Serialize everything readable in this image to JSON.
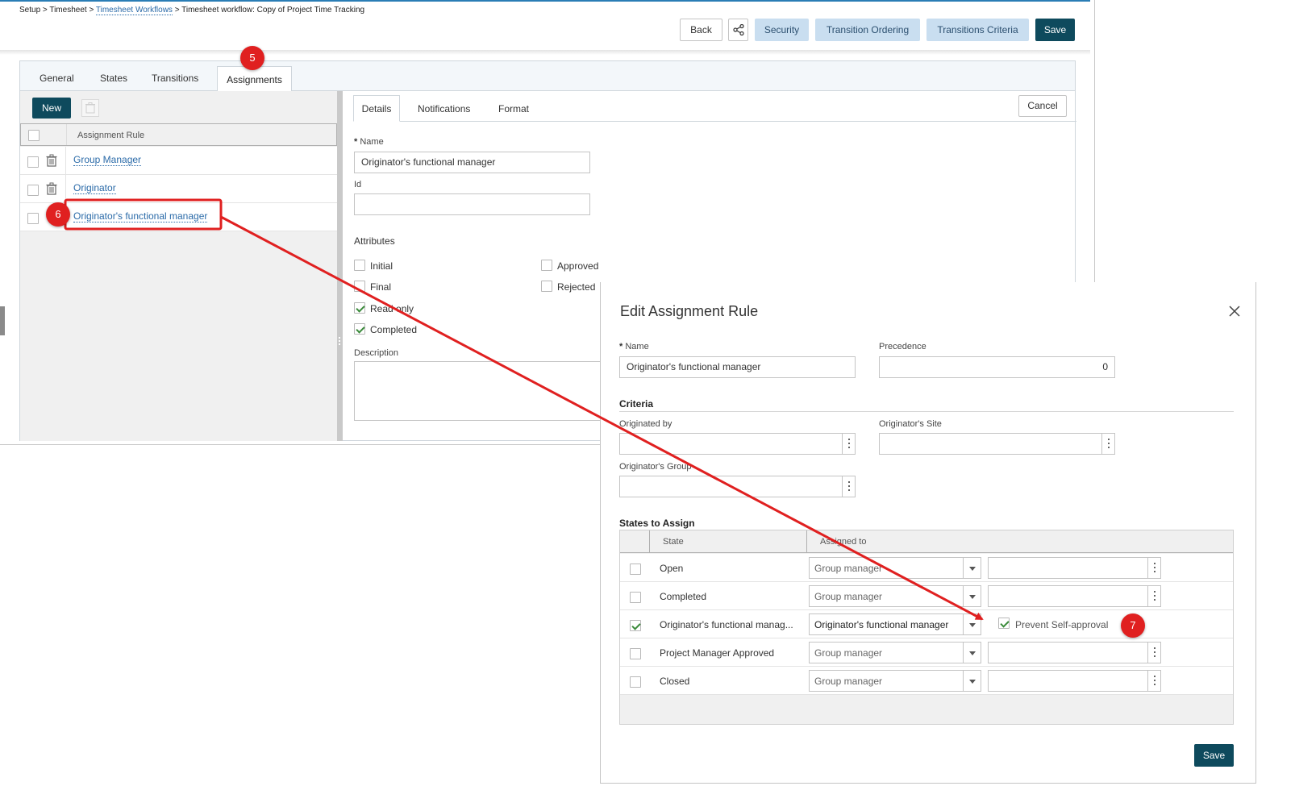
{
  "breadcrumb": {
    "part1": "Setup > Timesheet > ",
    "link": "Timesheet Workflows",
    "part2": " > Timesheet workflow: Copy of Project Time Tracking"
  },
  "toolbar": {
    "back": "Back",
    "security": "Security",
    "transition_ordering": "Transition Ordering",
    "transitions_criteria": "Transitions Criteria",
    "save": "Save"
  },
  "main_tabs": [
    "General",
    "States",
    "Transitions",
    "Assignments"
  ],
  "left_pane": {
    "new_label": "New",
    "column_header": "Assignment Rule",
    "rules": [
      "Group Manager",
      "Originator",
      "Originator's functional manager"
    ]
  },
  "detail": {
    "tabs": [
      "Details",
      "Notifications",
      "Format"
    ],
    "cancel": "Cancel",
    "name_label": "Name",
    "name_value": "Originator's functional manager",
    "id_label": "Id",
    "attributes_label": "Attributes",
    "attributes": {
      "initial": "Initial",
      "final": "Final",
      "read_only": "Read only",
      "completed": "Completed",
      "approved": "Approved",
      "rejected": "Rejected"
    },
    "description_label": "Description"
  },
  "modal": {
    "title": "Edit Assignment Rule",
    "name_label": "Name",
    "name_value": "Originator's functional manager",
    "precedence_label": "Precedence",
    "precedence_value": "0",
    "criteria_label": "Criteria",
    "originated_by_label": "Originated by",
    "originators_site_label": "Originator's Site",
    "originators_group_label": "Originator's Group",
    "states_label": "States to Assign",
    "col_state": "State",
    "col_assigned": "Assigned to",
    "states": [
      {
        "name": "Open",
        "assigned": "Group manager",
        "checked": false
      },
      {
        "name": "Completed",
        "assigned": "Group manager",
        "checked": false
      },
      {
        "name": "Originator's functional manag...",
        "assigned": "Originator's functional  manager",
        "checked": true,
        "extra": "Prevent Self-approval"
      },
      {
        "name": "Project Manager Approved",
        "assigned": "Group manager",
        "checked": false
      },
      {
        "name": "Closed",
        "assigned": "Group manager",
        "checked": false
      }
    ],
    "save": "Save"
  },
  "callouts": [
    "5",
    "6",
    "7"
  ],
  "colors": {
    "accent_dark": "#0e4a5d",
    "accent_light": "#c9def0",
    "link": "#2a6aa8",
    "callout": "#e02020"
  }
}
